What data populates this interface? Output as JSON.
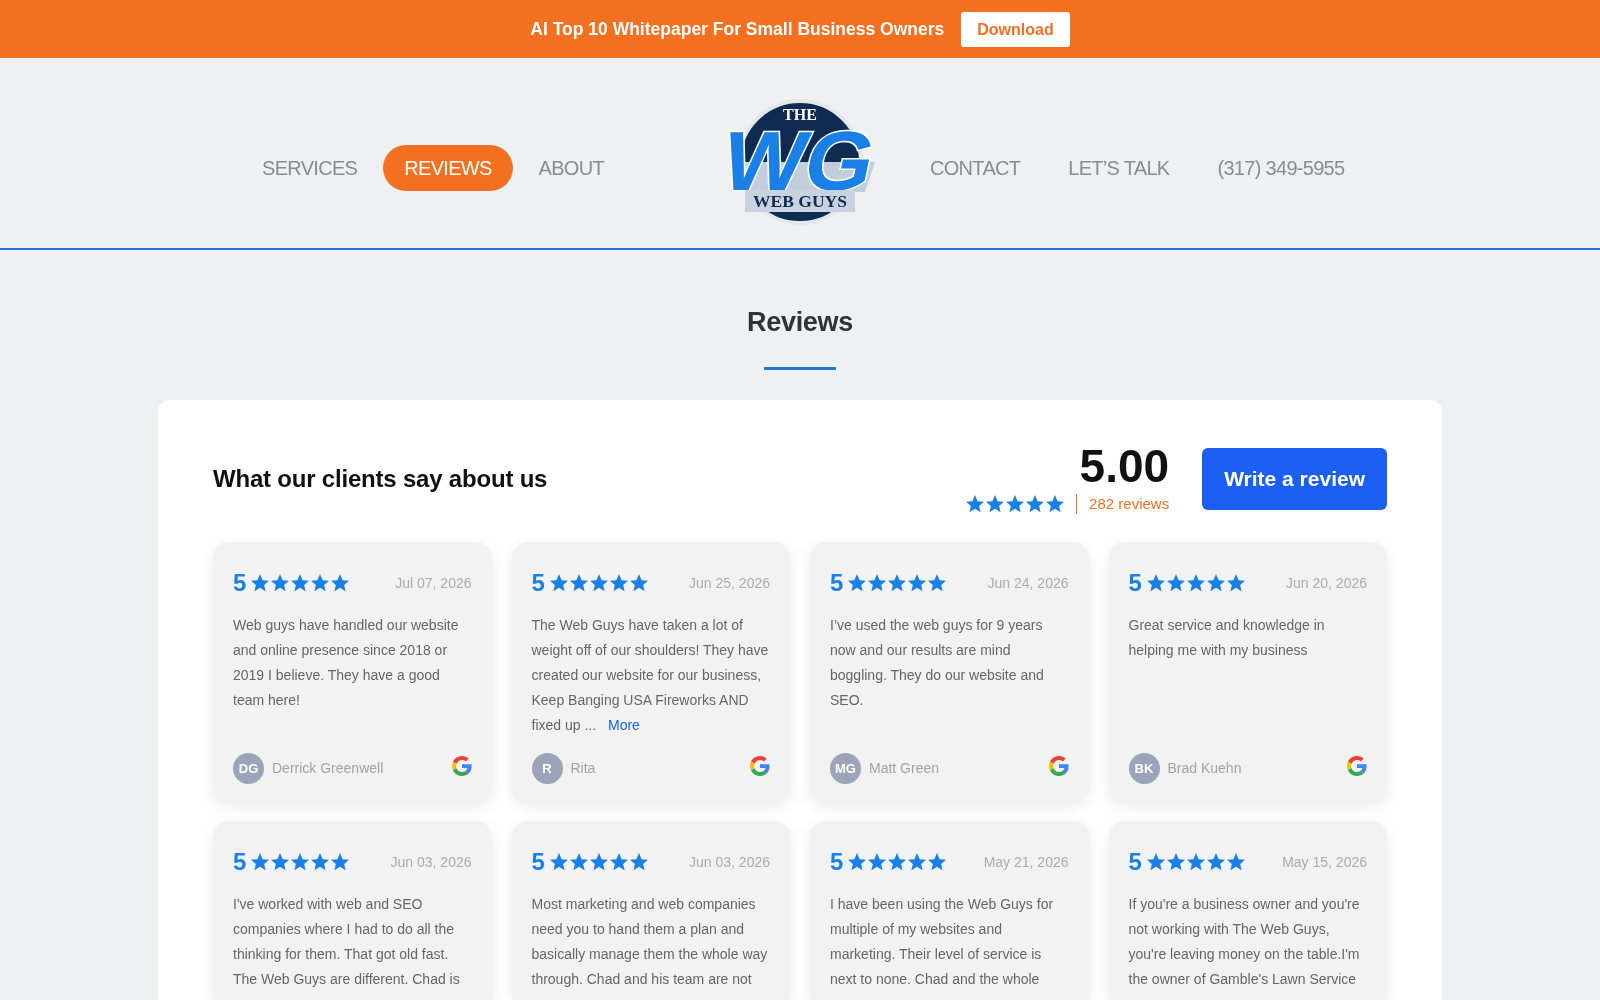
{
  "promo_banner": {
    "text": "AI Top 10 Whitepaper For Small Business Owners",
    "button": "Download"
  },
  "nav": {
    "left": [
      {
        "label": "SERVICES",
        "selected": false
      },
      {
        "label": "REVIEWS",
        "selected": true
      },
      {
        "label": "ABOUT",
        "selected": false
      }
    ],
    "logo": {
      "top": "THE",
      "monogram": "WG",
      "bottom": "WEB GUYS"
    },
    "right": [
      {
        "label": "CONTACT",
        "selected": false
      },
      {
        "label": "LET’S TALK",
        "selected": false
      },
      {
        "label": "(317) 349-5955",
        "selected": false
      }
    ]
  },
  "page_title": "Reviews",
  "summary": {
    "heading": "What our clients say about us",
    "score": "5.00",
    "stars": 5,
    "count": "282 reviews",
    "button": "Write a review"
  },
  "reviews": [
    {
      "rating": "5",
      "stars": 5,
      "date": "Jul 07, 2026",
      "text": "Web guys have handled our website and online presence since 2018 or 2019 I believe. They have a good team here!",
      "initials": "DG",
      "author": "Derrick Greenwell"
    },
    {
      "rating": "5",
      "stars": 5,
      "date": "Jun 25, 2026",
      "text": "The Web Guys have taken a lot of weight off of our shoulders! They have created our website for our business, Keep Banging USA Fireworks AND fixed up ...",
      "more": "More",
      "initials": "R",
      "author": "Rita"
    },
    {
      "rating": "5",
      "stars": 5,
      "date": "Jun 24, 2026",
      "text": "I’ve used the web guys for 9 years now and our results are mind boggling. They do our website and SEO.",
      "initials": "MG",
      "author": "Matt Green"
    },
    {
      "rating": "5",
      "stars": 5,
      "date": "Jun 20, 2026",
      "text": "Great service and knowledge in helping me with my business",
      "initials": "BK",
      "author": "Brad Kuehn"
    },
    {
      "rating": "5",
      "stars": 5,
      "date": "Jun 03, 2026",
      "text": "I've worked with web and SEO companies where I had to do all the thinking for them. That got old fast. The Web Guys are different. Chad is"
    },
    {
      "rating": "5",
      "stars": 5,
      "date": "Jun 03, 2026",
      "text": "Most marketing and web companies need you to hand them a plan and basically manage them the whole way through. Chad and his team are not"
    },
    {
      "rating": "5",
      "stars": 5,
      "date": "May 21, 2026",
      "text": "I have been using the Web Guys for multiple of my websites and marketing. Their level of service is next to none. Chad and the whole"
    },
    {
      "rating": "5",
      "stars": 5,
      "date": "May 15, 2026",
      "text": "If you're a business owner and you're not working with The Web Guys, you're leaving money on the table.I'm the owner of Gamble's Lawn Service"
    }
  ]
}
